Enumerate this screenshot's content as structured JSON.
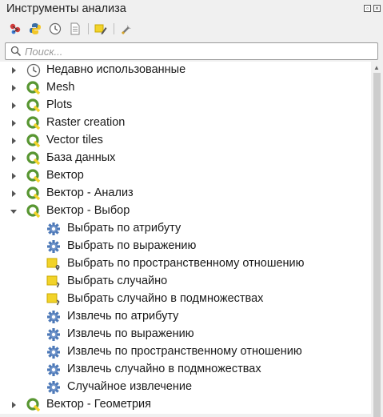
{
  "panel": {
    "title": "Инструменты анализа"
  },
  "search": {
    "placeholder": "Поиск..."
  },
  "toolbar": {
    "icons": [
      "models-icon",
      "python-icon",
      "history-icon",
      "results-icon",
      "edit-features-icon",
      "options-icon"
    ]
  },
  "tree": {
    "groups": [
      {
        "label": "Недавно использованные",
        "icon": "clock-icon",
        "expanded": false
      },
      {
        "label": "Mesh",
        "icon": "qgis-icon",
        "expanded": false
      },
      {
        "label": "Plots",
        "icon": "qgis-icon",
        "expanded": false
      },
      {
        "label": "Raster creation",
        "icon": "qgis-icon",
        "expanded": false
      },
      {
        "label": "Vector tiles",
        "icon": "qgis-icon",
        "expanded": false
      },
      {
        "label": "База данных",
        "icon": "qgis-icon",
        "expanded": false
      },
      {
        "label": "Вектор",
        "icon": "qgis-icon",
        "expanded": false
      },
      {
        "label": "Вектор - Анализ",
        "icon": "qgis-icon",
        "expanded": false
      },
      {
        "label": "Вектор - Выбор",
        "icon": "qgis-icon",
        "expanded": true
      },
      {
        "label": "Вектор - Геометрия",
        "icon": "qgis-icon",
        "expanded": false
      }
    ],
    "tools": [
      {
        "label": "Выбрать по атрибуту",
        "icon": "gear-icon"
      },
      {
        "label": "Выбрать по выражению",
        "icon": "gear-icon"
      },
      {
        "label": "Выбрать по пространственному отношению",
        "icon": "select-location-icon"
      },
      {
        "label": "Выбрать случайно",
        "icon": "select-random-icon"
      },
      {
        "label": "Выбрать случайно в подмножествах",
        "icon": "select-random-icon"
      },
      {
        "label": "Извлечь по атрибуту",
        "icon": "gear-icon"
      },
      {
        "label": "Извлечь по выражению",
        "icon": "gear-icon"
      },
      {
        "label": "Извлечь по пространственному отношению",
        "icon": "gear-icon"
      },
      {
        "label": "Извлечь случайно в подмножествах",
        "icon": "gear-icon"
      },
      {
        "label": "Случайное извлечение",
        "icon": "gear-icon"
      }
    ]
  },
  "colors": {
    "qgis_green": "#589632",
    "qgis_yellow": "#f2d32a",
    "gear_blue": "#4d79b8"
  }
}
